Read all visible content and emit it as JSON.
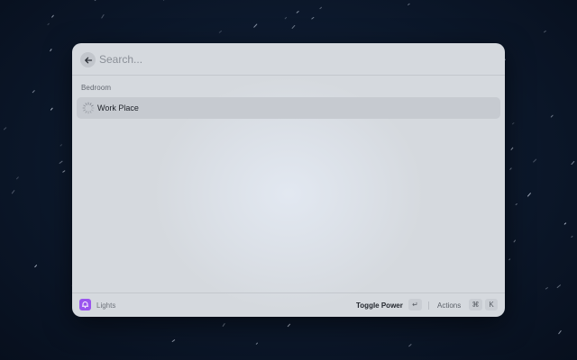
{
  "search": {
    "placeholder": "Search..."
  },
  "list": {
    "section_title": "Bedroom",
    "items": [
      {
        "title": "Work Place",
        "icon": "loading-spinner-icon",
        "selected": true
      }
    ]
  },
  "footer": {
    "app_name": "Lights",
    "app_icon": "lights-extension-icon",
    "primary_action": "Toggle Power",
    "primary_shortcut": "↵",
    "secondary_action": "Actions",
    "secondary_shortcut": [
      "⌘",
      "K"
    ]
  },
  "colors": {
    "accent": "#9a55ee",
    "selection": "#c6cad0",
    "background": "#0d1a2e"
  }
}
